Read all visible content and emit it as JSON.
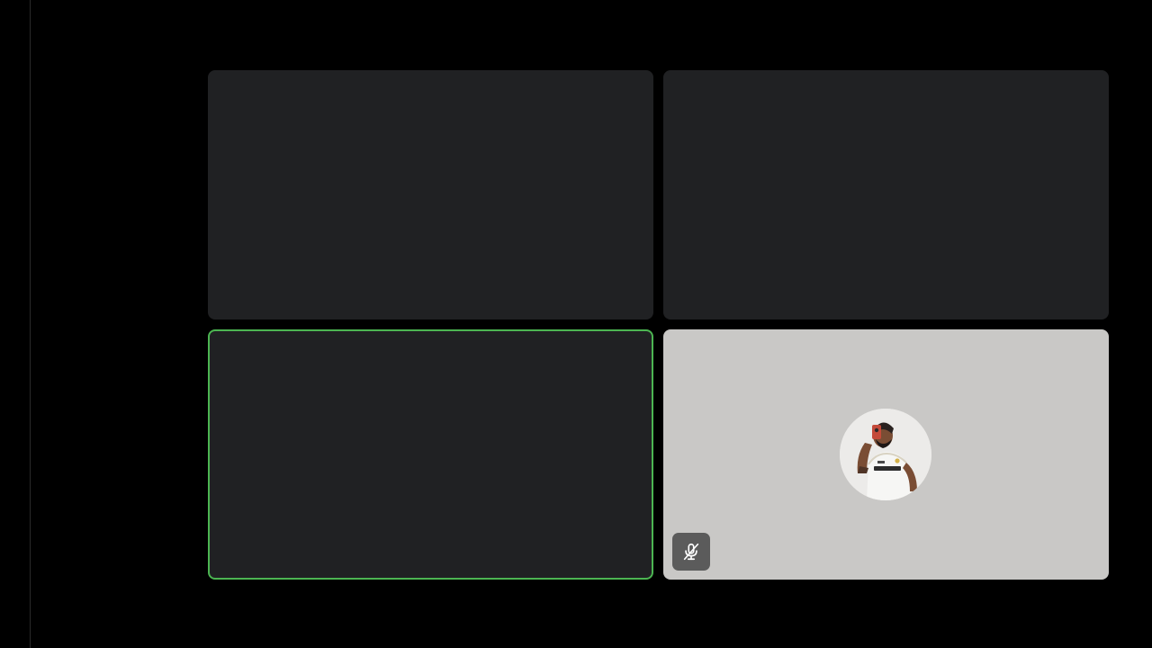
{
  "app": {
    "name": "video-call-gallery"
  },
  "colors": {
    "background": "#000000",
    "tile_dark": "#202123",
    "tile_light": "#c9c8c6",
    "speaking_border": "#4cb552",
    "mute_button": "#5b5b5b"
  },
  "tiles": [
    {
      "id": "participant-1",
      "video": "off"
    },
    {
      "id": "participant-2",
      "video": "off"
    },
    {
      "id": "participant-3",
      "video": "off",
      "speaking": true
    },
    {
      "id": "participant-4",
      "video": "off",
      "avatar": "profile-photo",
      "muted": true
    }
  ],
  "icons": {
    "mute": "mic-off-icon",
    "avatar": "profile-photo"
  }
}
